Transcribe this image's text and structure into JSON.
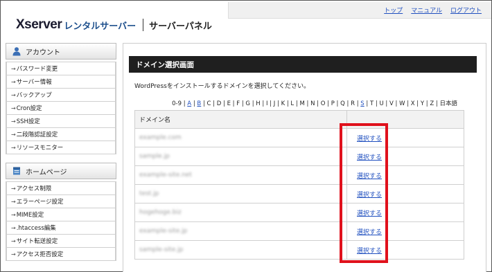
{
  "header": {
    "logo_brand": "Xserver",
    "logo_sub": "レンタルサーバー",
    "logo_panel": "サーバーパネル",
    "nav": [
      "トップ",
      "マニュアル",
      "ログアウト"
    ]
  },
  "sidebar": {
    "account_title": "アカウント",
    "account_items": [
      "パスワード変更",
      "サーバー情報",
      "バックアップ",
      "Cron設定",
      "SSH設定",
      "二段階認証設定",
      "リソースモニター"
    ],
    "homepage_title": "ホームページ",
    "homepage_items": [
      "アクセス制限",
      "エラーページ設定",
      "MIME設定",
      ".htaccess編集",
      "サイト転送設定",
      "アクセス拒否設定"
    ]
  },
  "main": {
    "title": "ドメイン選択画面",
    "description": "WordPressをインストールするドメインを選択してください。",
    "alpha_index": [
      "0-9",
      "A",
      "B",
      "C",
      "D",
      "E",
      "F",
      "G",
      "H",
      "I",
      "J",
      "K",
      "L",
      "M",
      "N",
      "O",
      "P",
      "Q",
      "R",
      "S",
      "T",
      "U",
      "V",
      "W",
      "X",
      "Y",
      "Z",
      "日本語"
    ],
    "alpha_linked": [
      "A",
      "B",
      "S"
    ],
    "table_header": "ドメイン名",
    "select_label": "選択する",
    "domains": [
      "example.com",
      "sample.jp",
      "example-site.net",
      "test.jp",
      "hogehoge.biz",
      "example-site.jp",
      "sample-site.jp"
    ]
  },
  "colors": {
    "link": "#1f4fbf",
    "title_bar": "#1f1f1f",
    "highlight": "#e0111c",
    "brand_blue": "#1d4f8c"
  }
}
